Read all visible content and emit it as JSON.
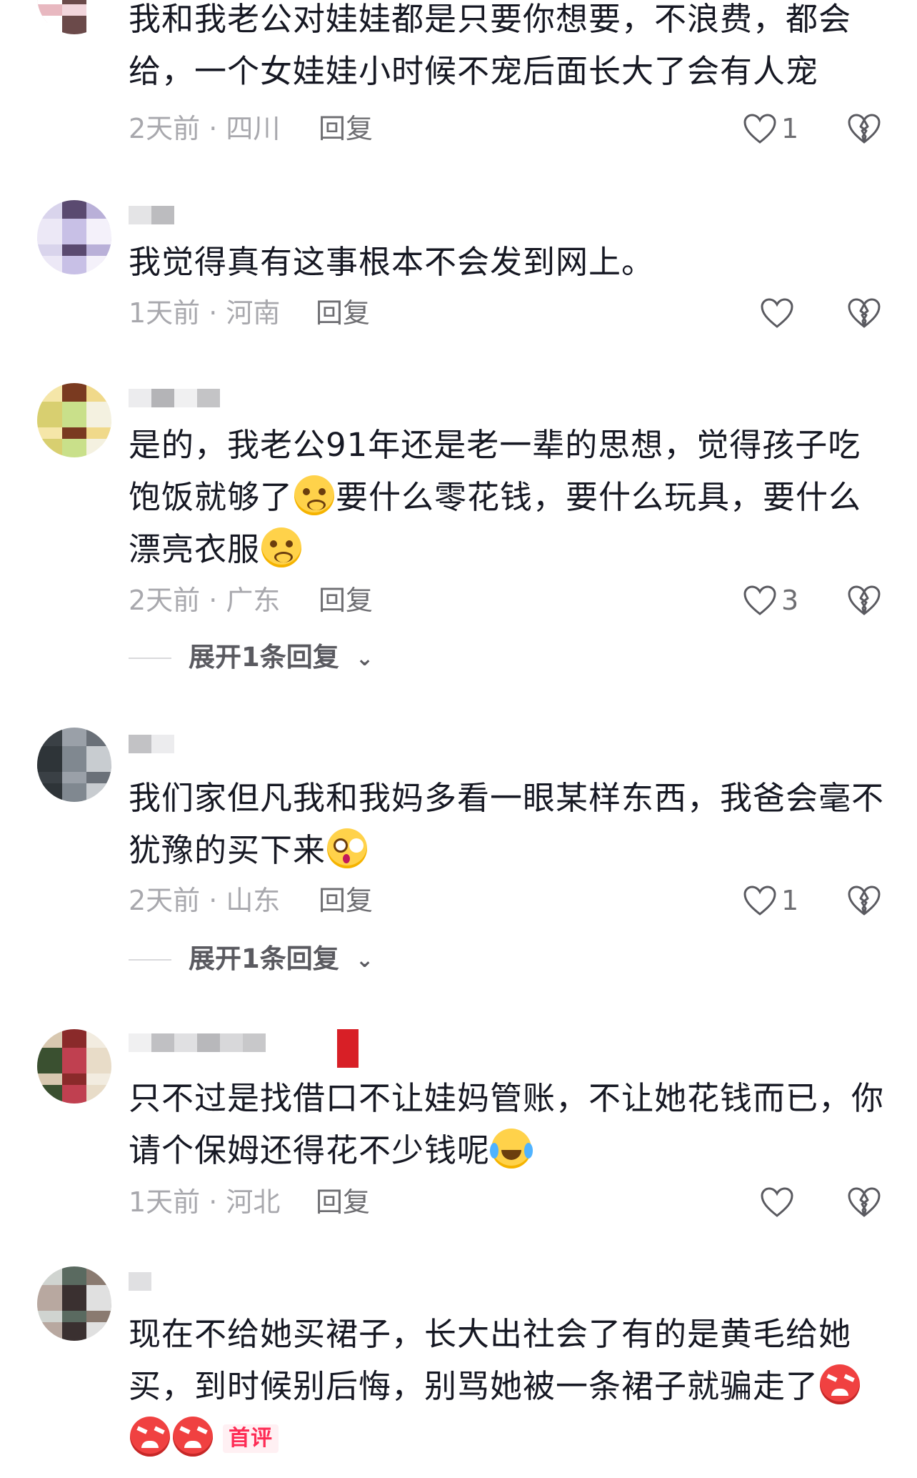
{
  "comments": [
    {
      "text_before": "我和我老公对娃娃都是只要你想要，不浪费，都会给，一个女娃娃小时候不宠后面长大了会有人宠",
      "time": "2天前 · 四川",
      "reply": "回复",
      "likes": "1",
      "avatar_colors": [
        "#e8b8c0",
        "#f2d6dc",
        "#ffffff",
        "#ffffff",
        "#6b4a4a",
        "#ffffff"
      ]
    },
    {
      "text_before": "我觉得真有这事根本不会发到网上。",
      "time": "1天前 · 河南",
      "reply": "回复",
      "likes": "",
      "avatar_colors": [
        "#d9d4ec",
        "#5a4a70",
        "#b9b0d8",
        "#ece8f6",
        "#c8c0e6",
        "#f4f1fa"
      ]
    },
    {
      "text_before": "是的，我老公91年还是老一辈的思想，觉得孩子吃饱饭就够了",
      "text_mid": "要什么零花钱，要什么玩具，要什么漂亮衣服",
      "time": "2天前 · 广东",
      "reply": "回复",
      "likes": "3",
      "expand": "展开1条回复",
      "avatar_colors": [
        "#f5e6a8",
        "#7a3a20",
        "#f0d98a",
        "#d8cf70",
        "#c9e08a",
        "#f4f1e0"
      ]
    },
    {
      "text_before": "我们家但凡我和我妈多看一眼某样东西，我爸会毫不犹豫的买下来",
      "time": "2天前 · 山东",
      "reply": "回复",
      "likes": "1",
      "expand": "展开1条回复",
      "avatar_colors": [
        "#3a4045",
        "#9aa0a8",
        "#6a7078",
        "#2e3438",
        "#808890",
        "#c8ccd0"
      ]
    },
    {
      "text_before": "只不过是找借口不让娃妈管账，不让她花钱而已，你请个保姆还得花不少钱呢",
      "time": "1天前 · 河北",
      "reply": "回复",
      "likes": "",
      "avatar_colors": [
        "#d8c8b0",
        "#8a2a2a",
        "#f2ece0",
        "#3a5030",
        "#c04050",
        "#e8dcc8"
      ]
    },
    {
      "text_before": "现在不给她买裙子，长大出社会了有的是黄毛给她买，到时候别后悔，别骂她被一条裙子就骗走了",
      "badge": "首评",
      "avatar_colors": [
        "#d0d4d0",
        "#5a6a60",
        "#8a7a70",
        "#b8a8a0",
        "#3a3030",
        "#e0e0e0"
      ]
    }
  ],
  "username_blocks": [
    [
      "#e4e4e6",
      "#bcbcbf"
    ],
    [
      "#ececee",
      "#b4b4b7",
      "#f0f0f1",
      "#c4c4c6"
    ],
    [
      "#d0d0d2",
      "#e6e6e8",
      "#a8a8ab",
      "#e8e8ea",
      "#b0b0b3"
    ],
    [
      "#c2c2c5",
      "#ececee"
    ],
    [
      "#f0f0f1",
      "#c0c0c3",
      "#e0e0e2",
      "#b8b8bb",
      "#d8d8da",
      "#c8c8ca"
    ],
    [
      "#e0e0e2"
    ]
  ]
}
